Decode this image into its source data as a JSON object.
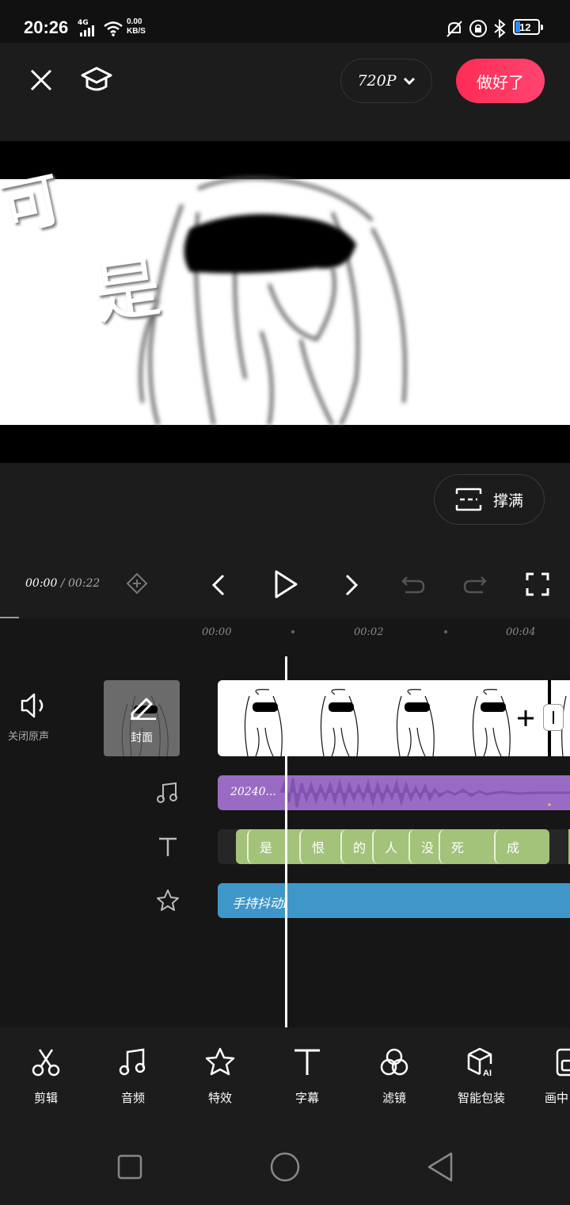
{
  "status_bar": {
    "time": "20:26",
    "signal": "4G",
    "net_speed": "0.00",
    "net_unit": "KB/S",
    "battery": "12"
  },
  "toolbar": {
    "resolution": "720P",
    "done_label": "做好了"
  },
  "preview": {
    "caption_line1": "可",
    "caption_line2": "是"
  },
  "fill_button": {
    "label": "撑满"
  },
  "playback": {
    "current": "00:00",
    "separator": "/",
    "total": "00:22"
  },
  "timeline": {
    "ticks": [
      "00:00",
      "00:02",
      "00:04"
    ],
    "mute_label": "关闭原声",
    "cover_label": "封面",
    "audio_clip": "20240...",
    "text_segments": [
      "是",
      "恨",
      "的",
      "人",
      "没",
      "死",
      "成"
    ],
    "effect_clip": "手持抖动I"
  },
  "tools": [
    {
      "label": "剪辑",
      "icon": "scissors-icon"
    },
    {
      "label": "音频",
      "icon": "music-note-icon"
    },
    {
      "label": "特效",
      "icon": "sparkle-star-icon"
    },
    {
      "label": "字幕",
      "icon": "text-icon"
    },
    {
      "label": "滤镜",
      "icon": "filter-circles-icon"
    },
    {
      "label": "智能包装",
      "icon": "ai-box-icon"
    },
    {
      "label": "画中",
      "icon": "picture-in-picture-icon"
    }
  ],
  "colors": {
    "accent": "#fe2c55",
    "audio": "#9a6bc4",
    "text_track": "#a3c27a",
    "effect": "#3e97c8"
  }
}
